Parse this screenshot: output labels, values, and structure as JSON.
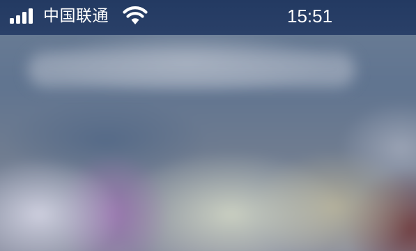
{
  "status_bar": {
    "carrier": "中国联通",
    "time": "15:51",
    "signal_bars": 4,
    "icons": {
      "signal": "cellular-signal-icon",
      "wifi": "wifi-icon"
    }
  },
  "colors": {
    "status_bar_bg": "#233a62",
    "status_bar_text": "#ffffff"
  }
}
